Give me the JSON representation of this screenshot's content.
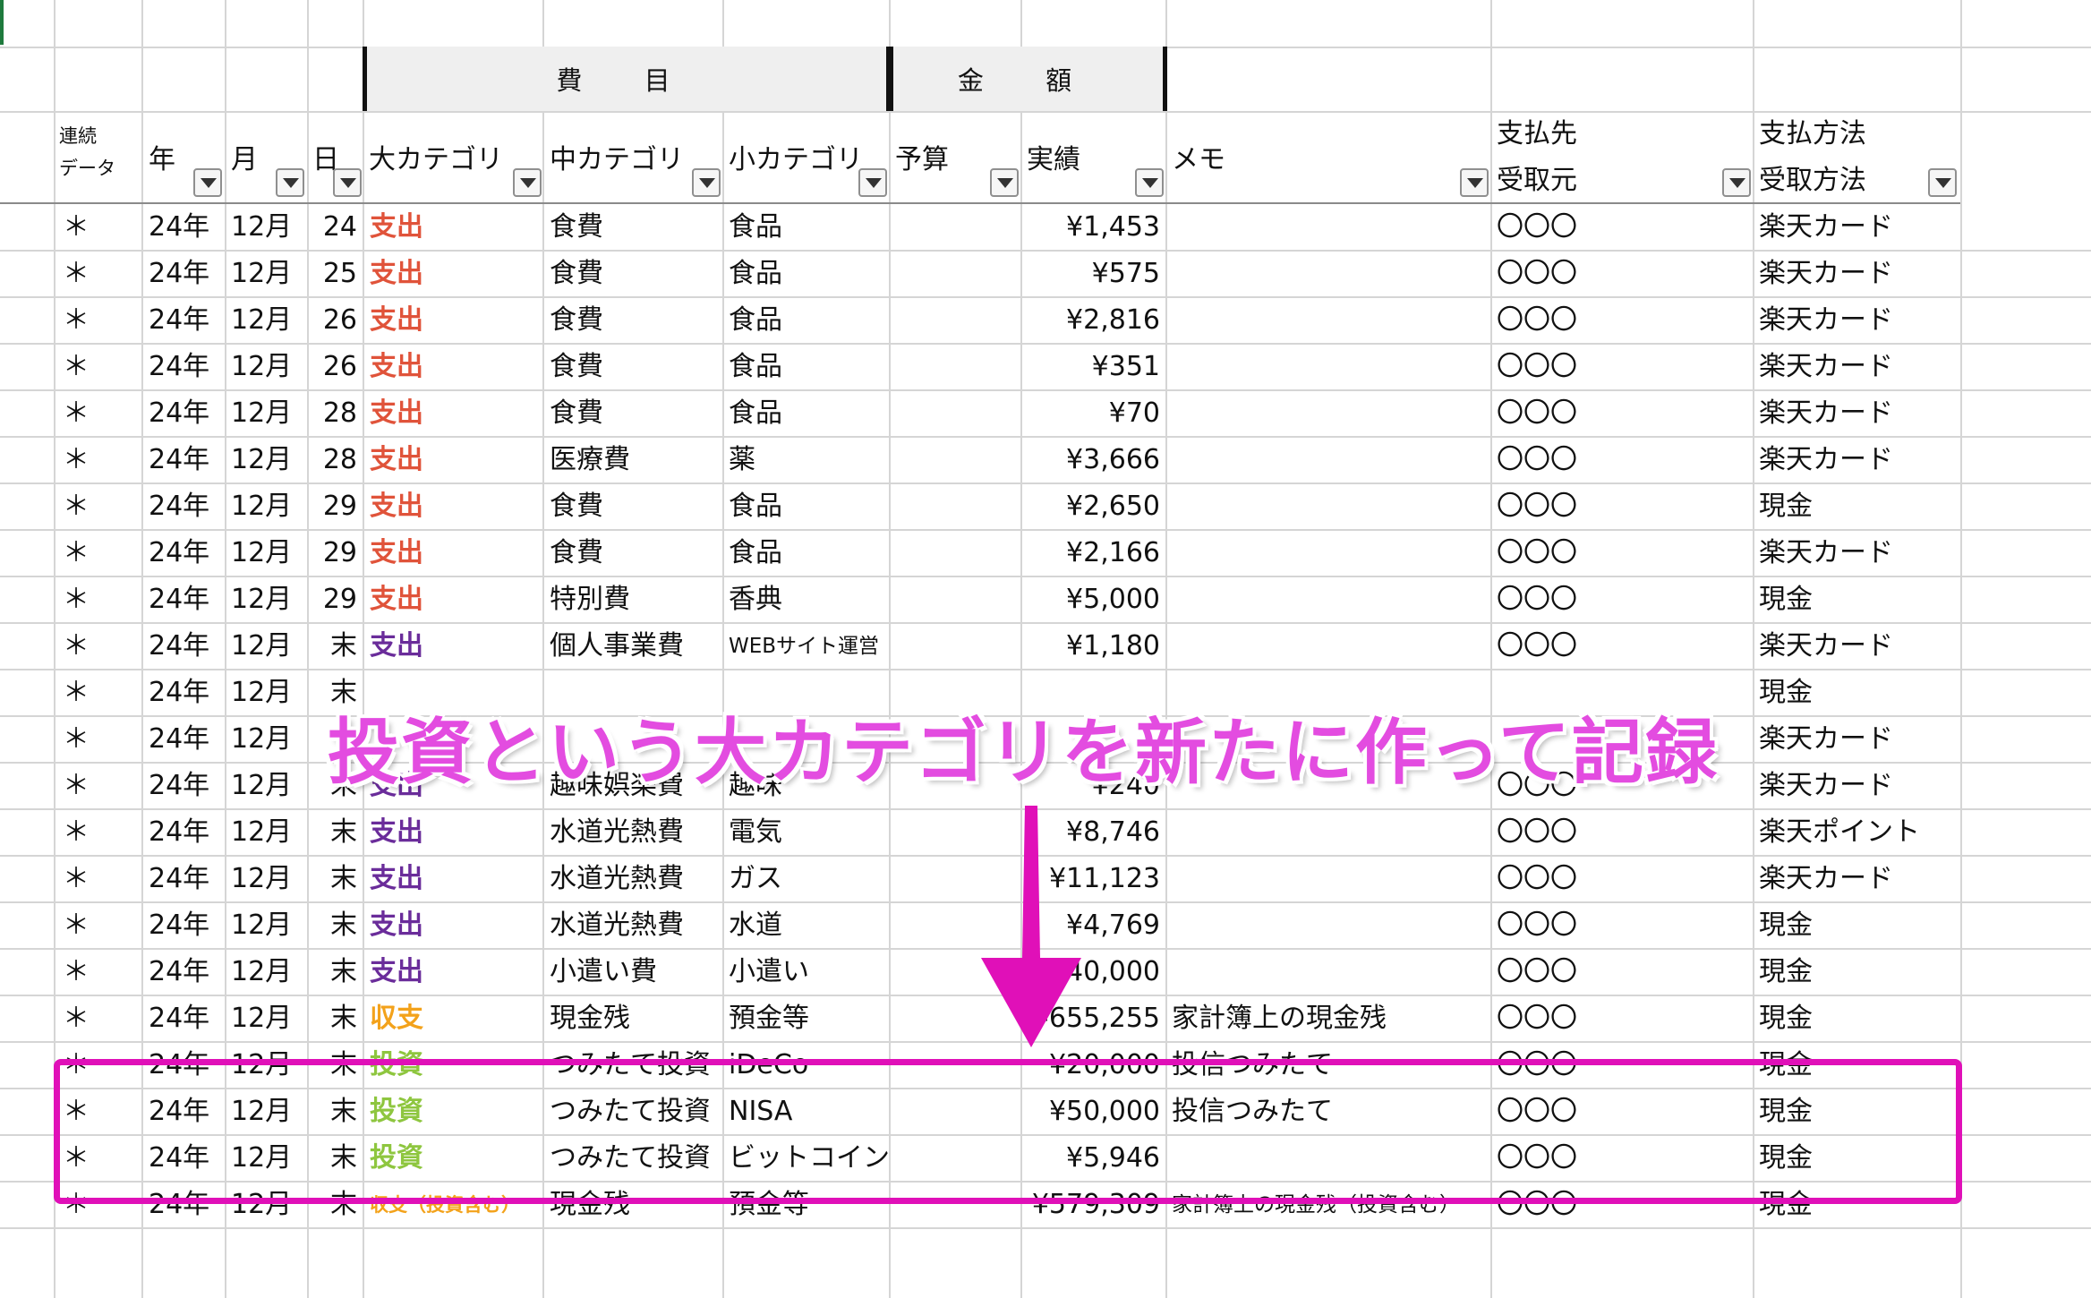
{
  "group_headers": {
    "himoku": "費 目",
    "kingaku": "金 額"
  },
  "headers": {
    "renzoku": [
      "連続",
      "データ"
    ],
    "nen": "年",
    "tsuki": "月",
    "hi": "日",
    "dai": "大カテゴリ",
    "chu": "中カテゴリ",
    "sho": "小カテゴリ",
    "yosan": "予算",
    "jisseki": "実績",
    "memo": "メモ",
    "shiharaisaki": [
      "支払先",
      "受取元"
    ],
    "houhou": [
      "支払方法",
      "受取方法"
    ]
  },
  "accent_colors": {
    "expense_red": "#e0533a",
    "expense_purple": "#6a2c9a",
    "balance_orange": "#f3a21b",
    "invest_green": "#8ec63f",
    "annotation_magenta": "#e010b8"
  },
  "rows": [
    {
      "flag": "＊",
      "year": "24年",
      "month": "12月",
      "day": "24",
      "cat": "支出",
      "cat_color": "red",
      "mid": "食費",
      "small": "食品",
      "budget": "",
      "actual": "¥1,453",
      "memo": "",
      "payee": "〇〇〇",
      "method": "楽天カード"
    },
    {
      "flag": "＊",
      "year": "24年",
      "month": "12月",
      "day": "25",
      "cat": "支出",
      "cat_color": "red",
      "mid": "食費",
      "small": "食品",
      "budget": "",
      "actual": "¥575",
      "memo": "",
      "payee": "〇〇〇",
      "method": "楽天カード"
    },
    {
      "flag": "＊",
      "year": "24年",
      "month": "12月",
      "day": "26",
      "cat": "支出",
      "cat_color": "red",
      "mid": "食費",
      "small": "食品",
      "budget": "",
      "actual": "¥2,816",
      "memo": "",
      "payee": "〇〇〇",
      "method": "楽天カード"
    },
    {
      "flag": "＊",
      "year": "24年",
      "month": "12月",
      "day": "26",
      "cat": "支出",
      "cat_color": "red",
      "mid": "食費",
      "small": "食品",
      "budget": "",
      "actual": "¥351",
      "memo": "",
      "payee": "〇〇〇",
      "method": "楽天カード"
    },
    {
      "flag": "＊",
      "year": "24年",
      "month": "12月",
      "day": "28",
      "cat": "支出",
      "cat_color": "red",
      "mid": "食費",
      "small": "食品",
      "budget": "",
      "actual": "¥70",
      "memo": "",
      "payee": "〇〇〇",
      "method": "楽天カード"
    },
    {
      "flag": "＊",
      "year": "24年",
      "month": "12月",
      "day": "28",
      "cat": "支出",
      "cat_color": "red",
      "mid": "医療費",
      "small": "薬",
      "budget": "",
      "actual": "¥3,666",
      "memo": "",
      "payee": "〇〇〇",
      "method": "楽天カード"
    },
    {
      "flag": "＊",
      "year": "24年",
      "month": "12月",
      "day": "29",
      "cat": "支出",
      "cat_color": "red",
      "mid": "食費",
      "small": "食品",
      "budget": "",
      "actual": "¥2,650",
      "memo": "",
      "payee": "〇〇〇",
      "method": "現金"
    },
    {
      "flag": "＊",
      "year": "24年",
      "month": "12月",
      "day": "29",
      "cat": "支出",
      "cat_color": "red",
      "mid": "食費",
      "small": "食品",
      "budget": "",
      "actual": "¥2,166",
      "memo": "",
      "payee": "〇〇〇",
      "method": "楽天カード"
    },
    {
      "flag": "＊",
      "year": "24年",
      "month": "12月",
      "day": "29",
      "cat": "支出",
      "cat_color": "red",
      "mid": "特別費",
      "small": "香典",
      "budget": "",
      "actual": "¥5,000",
      "memo": "",
      "payee": "〇〇〇",
      "method": "現金"
    },
    {
      "flag": "＊",
      "year": "24年",
      "month": "12月",
      "day": "末",
      "cat": "支出",
      "cat_color": "purple",
      "mid": "個人事業費",
      "small": "WEBサイト運営",
      "small_size": "small",
      "budget": "",
      "actual": "¥1,180",
      "memo": "",
      "payee": "〇〇〇",
      "method": "楽天カード"
    },
    {
      "flag": "＊",
      "year": "24年",
      "month": "12月",
      "day": "末",
      "cat": "",
      "cat_color": "purple",
      "mid": "",
      "small": "",
      "budget": "",
      "actual": "",
      "memo": "",
      "payee": "",
      "method": "現金"
    },
    {
      "flag": "＊",
      "year": "24年",
      "month": "12月",
      "day": "",
      "cat": "",
      "cat_color": "purple",
      "mid": "",
      "small": "",
      "budget": "",
      "actual": "",
      "memo": "",
      "payee": "",
      "method": "楽天カード"
    },
    {
      "flag": "＊",
      "year": "24年",
      "month": "12月",
      "day": "末",
      "cat": "支出",
      "cat_color": "purple",
      "mid": "趣味娯楽費",
      "small": "趣味",
      "budget": "",
      "actual": "¥240",
      "memo": "",
      "payee": "〇〇〇",
      "method": "楽天カード"
    },
    {
      "flag": "＊",
      "year": "24年",
      "month": "12月",
      "day": "末",
      "cat": "支出",
      "cat_color": "purple",
      "mid": "水道光熱費",
      "small": "電気",
      "budget": "",
      "actual": "¥8,746",
      "memo": "",
      "payee": "〇〇〇",
      "method": "楽天ポイント"
    },
    {
      "flag": "＊",
      "year": "24年",
      "month": "12月",
      "day": "末",
      "cat": "支出",
      "cat_color": "purple",
      "mid": "水道光熱費",
      "small": "ガス",
      "budget": "",
      "actual": "¥11,123",
      "memo": "",
      "payee": "〇〇〇",
      "method": "楽天カード"
    },
    {
      "flag": "＊",
      "year": "24年",
      "month": "12月",
      "day": "末",
      "cat": "支出",
      "cat_color": "purple",
      "mid": "水道光熱費",
      "small": "水道",
      "budget": "",
      "actual": "¥4,769",
      "memo": "",
      "payee": "〇〇〇",
      "method": "現金"
    },
    {
      "flag": "＊",
      "year": "24年",
      "month": "12月",
      "day": "末",
      "cat": "支出",
      "cat_color": "purple",
      "mid": "小遣い費",
      "small": "小遣い",
      "budget": "",
      "actual": "¥40,000",
      "memo": "",
      "payee": "〇〇〇",
      "method": "現金"
    },
    {
      "flag": "＊",
      "year": "24年",
      "month": "12月",
      "day": "末",
      "cat": "収支",
      "cat_color": "orange",
      "mid": "現金残",
      "small": "預金等",
      "budget": "",
      "actual": "¥655,255",
      "memo": "家計簿上の現金残",
      "payee": "〇〇〇",
      "method": "現金"
    },
    {
      "flag": "＊",
      "year": "24年",
      "month": "12月",
      "day": "末",
      "cat": "投資",
      "cat_color": "green",
      "mid": "つみたて投資",
      "small": "iDeCo",
      "budget": "",
      "actual": "¥20,000",
      "memo": "投信つみたて",
      "payee": "〇〇〇",
      "method": "現金"
    },
    {
      "flag": "＊",
      "year": "24年",
      "month": "12月",
      "day": "末",
      "cat": "投資",
      "cat_color": "green",
      "mid": "つみたて投資",
      "small": "NISA",
      "budget": "",
      "actual": "¥50,000",
      "memo": "投信つみたて",
      "payee": "〇〇〇",
      "method": "現金"
    },
    {
      "flag": "＊",
      "year": "24年",
      "month": "12月",
      "day": "末",
      "cat": "投資",
      "cat_color": "green",
      "mid": "つみたて投資",
      "small": "ビットコイン",
      "budget": "",
      "actual": "¥5,946",
      "memo": "",
      "payee": "〇〇〇",
      "method": "現金"
    },
    {
      "flag": "＊",
      "year": "24年",
      "month": "12月",
      "day": "末",
      "cat": "収支（投資含む）",
      "cat_color": "orange",
      "cat_size": "tiny",
      "mid": "現金残",
      "small": "預金等",
      "budget": "",
      "actual": "¥579,309",
      "memo": "家計簿上の現金残（投資含む）",
      "memo_size": "small",
      "payee": "〇〇〇",
      "method": "現金"
    }
  ],
  "annotation": {
    "text": "投資という大カテゴリを新たに作って記録"
  }
}
